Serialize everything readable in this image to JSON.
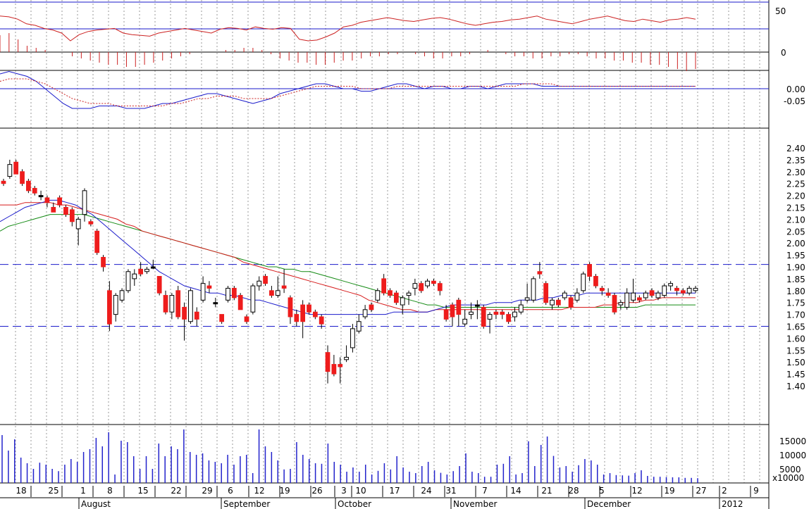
{
  "chart_data": {
    "type": "candlestick",
    "grid": "vertical dotted at day ticks",
    "x_day_labels": [
      "18",
      "25",
      "1",
      "8",
      "15",
      "22",
      "29",
      "6",
      "12",
      "19",
      "26",
      "3",
      "10",
      "17",
      "24",
      "31",
      "7",
      "14",
      "21",
      "28",
      "5",
      "12",
      "19",
      "27",
      "2",
      "9"
    ],
    "x_month_labels": [
      "August",
      "September",
      "October",
      "November",
      "December",
      "2012"
    ],
    "panels": {
      "rsi": {
        "yticks": [
          "50",
          "0"
        ],
        "reference_lines": [
          70,
          30
        ],
        "ylim": [
          0,
          100
        ],
        "values": [
          62,
          61,
          58,
          52,
          50,
          46,
          44,
          40,
          30,
          38,
          42,
          44,
          45,
          46,
          40,
          38,
          37,
          36,
          40,
          42,
          44,
          46,
          44,
          42,
          40,
          45,
          47,
          46,
          44,
          48,
          46,
          45,
          47,
          46,
          32,
          30,
          31,
          35,
          40,
          48,
          50,
          54,
          56,
          58,
          60,
          58,
          56,
          55,
          57,
          59,
          60,
          58,
          55,
          52,
          50,
          52,
          54,
          55,
          57,
          58,
          60,
          62,
          58,
          56,
          54,
          52,
          55,
          58,
          60,
          62,
          59,
          56,
          55,
          58,
          56,
          54,
          57,
          58,
          60,
          58
        ]
      },
      "hist": {
        "yticks": [
          "0"
        ],
        "values": [
          8,
          9,
          6,
          3,
          2,
          1,
          0,
          0,
          -2,
          -3,
          -4,
          -5,
          -6,
          -6,
          -7,
          -7,
          -6,
          -5,
          -4,
          -3,
          -2,
          -1,
          0,
          0,
          0,
          1,
          1,
          2,
          2,
          1,
          -1,
          -3,
          -4,
          -5,
          -5,
          -6,
          -6,
          -5,
          -4,
          -4,
          -3,
          -2,
          -2,
          -1,
          -1,
          0,
          -1,
          -2,
          -3,
          -3,
          -2,
          -2,
          -1,
          0,
          1,
          0,
          -1,
          -2,
          -2,
          -3,
          -3,
          -2,
          -2,
          -1,
          -1,
          -2,
          -3,
          -3,
          -4,
          -4,
          -5,
          -5,
          -6,
          -6,
          -7,
          -8,
          -9,
          -8
        ]
      },
      "macd": {
        "yticks": [
          "0.00",
          "-0.05"
        ],
        "macd": [
          0.06,
          0.07,
          0.06,
          0.05,
          0.03,
          0.0,
          -0.03,
          -0.06,
          -0.08,
          -0.08,
          -0.08,
          -0.07,
          -0.07,
          -0.07,
          -0.08,
          -0.08,
          -0.08,
          -0.07,
          -0.06,
          -0.06,
          -0.05,
          -0.04,
          -0.03,
          -0.02,
          -0.02,
          -0.03,
          -0.04,
          -0.05,
          -0.06,
          -0.05,
          -0.04,
          -0.02,
          -0.01,
          0.0,
          0.01,
          0.02,
          0.02,
          0.01,
          0.0,
          0.0,
          -0.01,
          -0.01,
          0.0,
          0.01,
          0.02,
          0.02,
          0.01,
          0.0,
          0.01,
          0.01,
          0.0,
          0.0,
          0.01,
          0.01,
          0.0,
          0.01,
          0.02,
          0.02,
          0.02,
          0.02,
          0.01,
          0.01,
          0.01,
          0.01,
          0.01,
          0.01,
          0.01,
          0.01,
          0.01,
          0.01,
          0.01,
          0.01,
          0.01,
          0.01,
          0.01,
          0.01,
          0.01,
          0.01
        ],
        "signal": [
          0.03,
          0.04,
          0.04,
          0.04,
          0.03,
          0.02,
          0.0,
          -0.02,
          -0.04,
          -0.05,
          -0.06,
          -0.06,
          -0.06,
          -0.07,
          -0.07,
          -0.07,
          -0.07,
          -0.07,
          -0.07,
          -0.06,
          -0.06,
          -0.05,
          -0.04,
          -0.04,
          -0.03,
          -0.03,
          -0.03,
          -0.04,
          -0.04,
          -0.04,
          -0.04,
          -0.03,
          -0.02,
          -0.01,
          0.0,
          0.01,
          0.01,
          0.01,
          0.01,
          0.01,
          0.0,
          0.0,
          0.0,
          0.0,
          0.01,
          0.01,
          0.01,
          0.01,
          0.01,
          0.01,
          0.01,
          0.01,
          0.01,
          0.01,
          0.01,
          0.01,
          0.01,
          0.01,
          0.02,
          0.02,
          0.02,
          0.02,
          0.01,
          0.01,
          0.01,
          0.01,
          0.01,
          0.01,
          0.01,
          0.01,
          0.01,
          0.01,
          0.01,
          0.01,
          0.01,
          0.01,
          0.01,
          0.01
        ]
      },
      "price": {
        "yticks": [
          "2.40",
          "2.35",
          "2.30",
          "2.25",
          "2.20",
          "2.15",
          "2.10",
          "2.05",
          "2.00",
          "1.95",
          "1.90",
          "1.85",
          "1.80",
          "1.75",
          "1.70",
          "1.65",
          "1.60",
          "1.55",
          "1.50",
          "1.45",
          "1.40"
        ],
        "ylim": [
          1.35,
          2.42
        ],
        "reference_levels": [
          1.91,
          1.65
        ]
      },
      "volume": {
        "yticks": [
          "15000",
          "10000",
          "5000"
        ],
        "unit_label": "x10000",
        "ylim": [
          0,
          20000
        ]
      }
    },
    "candles": [
      [
        2.26,
        2.27,
        2.24,
        2.25
      ],
      [
        2.28,
        2.35,
        2.27,
        2.33
      ],
      [
        2.34,
        2.35,
        2.29,
        2.29
      ],
      [
        2.3,
        2.31,
        2.24,
        2.25
      ],
      [
        2.26,
        2.27,
        2.21,
        2.22
      ],
      [
        2.23,
        2.24,
        2.2,
        2.21
      ],
      [
        2.2,
        2.22,
        2.18,
        2.2
      ],
      [
        2.19,
        2.2,
        2.15,
        2.17
      ],
      [
        2.15,
        2.17,
        2.13,
        2.13
      ],
      [
        2.19,
        2.2,
        2.15,
        2.16
      ],
      [
        2.15,
        2.16,
        2.11,
        2.12
      ],
      [
        2.14,
        2.15,
        2.07,
        2.09
      ],
      [
        2.06,
        2.11,
        1.99,
        2.1
      ],
      [
        2.12,
        2.23,
        2.09,
        2.22
      ],
      [
        2.09,
        2.1,
        2.07,
        2.08
      ],
      [
        2.05,
        2.06,
        1.95,
        1.96
      ],
      [
        1.94,
        1.95,
        1.88,
        1.9
      ],
      [
        1.8,
        1.84,
        1.63,
        1.66
      ],
      [
        1.7,
        1.79,
        1.67,
        1.78
      ],
      [
        1.76,
        1.81,
        1.75,
        1.8
      ],
      [
        1.8,
        1.89,
        1.79,
        1.88
      ],
      [
        1.85,
        1.89,
        1.82,
        1.87
      ],
      [
        1.89,
        1.92,
        1.86,
        1.87
      ],
      [
        1.88,
        1.9,
        1.87,
        1.89
      ],
      [
        1.9,
        1.93,
        1.89,
        1.9
      ],
      [
        1.86,
        1.86,
        1.78,
        1.79
      ],
      [
        1.78,
        1.8,
        1.7,
        1.71
      ],
      [
        1.71,
        1.79,
        1.68,
        1.78
      ],
      [
        1.8,
        1.82,
        1.68,
        1.69
      ],
      [
        1.73,
        1.75,
        1.59,
        1.68
      ],
      [
        1.67,
        1.81,
        1.66,
        1.8
      ],
      [
        1.71,
        1.73,
        1.65,
        1.68
      ],
      [
        1.76,
        1.86,
        1.75,
        1.83
      ],
      [
        1.82,
        1.84,
        1.79,
        1.81
      ],
      [
        1.75,
        1.77,
        1.73,
        1.75
      ],
      [
        1.7,
        1.69,
        1.66,
        1.67
      ],
      [
        1.76,
        1.82,
        1.75,
        1.81
      ],
      [
        1.81,
        1.82,
        1.76,
        1.77
      ],
      [
        1.78,
        1.79,
        1.72,
        1.72
      ],
      [
        1.69,
        1.7,
        1.66,
        1.67
      ],
      [
        1.71,
        1.83,
        1.7,
        1.82
      ],
      [
        1.82,
        1.86,
        1.8,
        1.84
      ],
      [
        1.86,
        1.87,
        1.82,
        1.83
      ],
      [
        1.8,
        1.82,
        1.77,
        1.78
      ],
      [
        1.78,
        1.86,
        1.77,
        1.8
      ],
      [
        1.82,
        1.89,
        1.79,
        1.81
      ],
      [
        1.77,
        1.78,
        1.66,
        1.69
      ],
      [
        1.7,
        1.72,
        1.65,
        1.67
      ],
      [
        1.74,
        1.76,
        1.6,
        1.67
      ],
      [
        1.74,
        1.75,
        1.7,
        1.71
      ],
      [
        1.71,
        1.72,
        1.68,
        1.69
      ],
      [
        1.69,
        1.7,
        1.64,
        1.66
      ],
      [
        1.54,
        1.57,
        1.41,
        1.46
      ],
      [
        1.49,
        1.53,
        1.44,
        1.45
      ],
      [
        1.49,
        1.52,
        1.41,
        1.48
      ],
      [
        1.51,
        1.57,
        1.5,
        1.52
      ],
      [
        1.56,
        1.66,
        1.54,
        1.64
      ],
      [
        1.63,
        1.7,
        1.62,
        1.67
      ],
      [
        1.69,
        1.74,
        1.68,
        1.72
      ],
      [
        1.74,
        1.75,
        1.71,
        1.72
      ],
      [
        1.76,
        1.81,
        1.75,
        1.8
      ],
      [
        1.85,
        1.87,
        1.78,
        1.79
      ],
      [
        1.8,
        1.81,
        1.77,
        1.78
      ],
      [
        1.79,
        1.8,
        1.74,
        1.75
      ],
      [
        1.74,
        1.78,
        1.7,
        1.77
      ],
      [
        1.78,
        1.8,
        1.74,
        1.79
      ],
      [
        1.81,
        1.85,
        1.78,
        1.83
      ],
      [
        1.83,
        1.84,
        1.79,
        1.8
      ],
      [
        1.82,
        1.85,
        1.81,
        1.84
      ],
      [
        1.84,
        1.85,
        1.82,
        1.83
      ],
      [
        1.83,
        1.84,
        1.78,
        1.8
      ],
      [
        1.72,
        1.74,
        1.67,
        1.68
      ],
      [
        1.74,
        1.75,
        1.65,
        1.69
      ],
      [
        1.76,
        1.77,
        1.65,
        1.7
      ],
      [
        1.66,
        1.72,
        1.65,
        1.68
      ],
      [
        1.7,
        1.75,
        1.68,
        1.71
      ],
      [
        1.74,
        1.76,
        1.68,
        1.74
      ],
      [
        1.73,
        1.74,
        1.64,
        1.65
      ],
      [
        1.68,
        1.71,
        1.62,
        1.7
      ],
      [
        1.71,
        1.72,
        1.68,
        1.7
      ],
      [
        1.71,
        1.72,
        1.68,
        1.7
      ],
      [
        1.7,
        1.71,
        1.66,
        1.67
      ],
      [
        1.69,
        1.73,
        1.67,
        1.71
      ],
      [
        1.71,
        1.76,
        1.7,
        1.74
      ],
      [
        1.76,
        1.83,
        1.75,
        1.77
      ],
      [
        1.76,
        1.86,
        1.75,
        1.85
      ],
      [
        1.88,
        1.92,
        1.85,
        1.87
      ],
      [
        1.83,
        1.84,
        1.74,
        1.75
      ],
      [
        1.74,
        1.77,
        1.72,
        1.76
      ],
      [
        1.76,
        1.77,
        1.73,
        1.74
      ],
      [
        1.77,
        1.8,
        1.76,
        1.79
      ],
      [
        1.77,
        1.78,
        1.72,
        1.73
      ],
      [
        1.76,
        1.81,
        1.75,
        1.79
      ],
      [
        1.8,
        1.88,
        1.79,
        1.87
      ],
      [
        1.91,
        1.92,
        1.84,
        1.86
      ],
      [
        1.86,
        1.87,
        1.81,
        1.82
      ],
      [
        1.81,
        1.82,
        1.78,
        1.8
      ],
      [
        1.79,
        1.81,
        1.77,
        1.78
      ],
      [
        1.78,
        1.79,
        1.7,
        1.71
      ],
      [
        1.74,
        1.76,
        1.72,
        1.75
      ],
      [
        1.73,
        1.81,
        1.72,
        1.79
      ],
      [
        1.76,
        1.85,
        1.75,
        1.79
      ],
      [
        1.77,
        1.78,
        1.75,
        1.76
      ],
      [
        1.77,
        1.8,
        1.76,
        1.79
      ],
      [
        1.8,
        1.81,
        1.77,
        1.78
      ],
      [
        1.77,
        1.8,
        1.76,
        1.79
      ],
      [
        1.78,
        1.83,
        1.77,
        1.82
      ],
      [
        1.82,
        1.84,
        1.8,
        1.83
      ],
      [
        1.81,
        1.82,
        1.78,
        1.8
      ],
      [
        1.8,
        1.81,
        1.78,
        1.79
      ],
      [
        1.79,
        1.82,
        1.78,
        1.81
      ],
      [
        1.8,
        1.82,
        1.79,
        1.81
      ]
    ],
    "ma_red": [
      2.16,
      2.16,
      2.16,
      2.17,
      2.17,
      2.17,
      2.17,
      2.16,
      2.16,
      2.15,
      2.14,
      2.13,
      2.12,
      2.11,
      2.1,
      2.08,
      2.07,
      2.05,
      2.04,
      2.03,
      2.02,
      2.01,
      2.0,
      1.99,
      1.98,
      1.97,
      1.96,
      1.95,
      1.94,
      1.92,
      1.91,
      1.9,
      1.89,
      1.88,
      1.87,
      1.86,
      1.85,
      1.84,
      1.83,
      1.82,
      1.81,
      1.8,
      1.79,
      1.78,
      1.76,
      1.75,
      1.74,
      1.73,
      1.72,
      1.72,
      1.71,
      1.71,
      1.72,
      1.72,
      1.72,
      1.72,
      1.72,
      1.72,
      1.72,
      1.72,
      1.72,
      1.72,
      1.72,
      1.72,
      1.72,
      1.72,
      1.72,
      1.72,
      1.73,
      1.73,
      1.73,
      1.73,
      1.74,
      1.74,
      1.75,
      1.75,
      1.75,
      1.76,
      1.76,
      1.77,
      1.77,
      1.77,
      1.77,
      1.77
    ],
    "ma_blue": [
      2.09,
      2.11,
      2.13,
      2.15,
      2.16,
      2.17,
      2.18,
      2.18,
      2.17,
      2.16,
      2.14,
      2.12,
      2.09,
      2.06,
      2.03,
      2.0,
      1.97,
      1.94,
      1.91,
      1.88,
      1.86,
      1.84,
      1.82,
      1.81,
      1.8,
      1.79,
      1.79,
      1.78,
      1.78,
      1.77,
      1.76,
      1.76,
      1.75,
      1.74,
      1.73,
      1.72,
      1.71,
      1.7,
      1.7,
      1.7,
      1.7,
      1.7,
      1.7,
      1.7,
      1.7,
      1.7,
      1.7,
      1.71,
      1.71,
      1.71,
      1.71,
      1.71,
      1.72,
      1.73,
      1.74,
      1.74,
      1.74,
      1.74,
      1.74,
      1.75,
      1.75,
      1.75,
      1.76,
      1.76,
      1.76,
      1.77,
      1.77,
      1.78,
      1.78,
      1.78,
      1.79,
      1.79,
      1.79,
      1.79,
      1.79,
      1.79,
      1.79,
      1.79,
      1.79,
      1.79,
      1.79,
      1.79,
      1.79,
      1.79
    ],
    "ma_green": [
      2.05,
      2.07,
      2.08,
      2.09,
      2.1,
      2.11,
      2.12,
      2.12,
      2.12,
      2.12,
      2.12,
      2.11,
      2.1,
      2.09,
      2.08,
      2.07,
      2.06,
      2.05,
      2.04,
      2.03,
      2.02,
      2.01,
      2.0,
      1.99,
      1.98,
      1.97,
      1.96,
      1.95,
      1.94,
      1.93,
      1.92,
      1.91,
      1.9,
      1.9,
      1.89,
      1.89,
      1.88,
      1.88,
      1.87,
      1.86,
      1.85,
      1.84,
      1.83,
      1.82,
      1.81,
      1.8,
      1.79,
      1.78,
      1.77,
      1.76,
      1.75,
      1.74,
      1.74,
      1.73,
      1.73,
      1.73,
      1.73,
      1.73,
      1.73,
      1.73,
      1.73,
      1.73,
      1.73,
      1.73,
      1.73,
      1.73,
      1.73,
      1.73,
      1.73,
      1.73,
      1.73,
      1.73,
      1.73,
      1.73,
      1.73,
      1.73,
      1.73,
      1.74,
      1.74,
      1.74,
      1.74,
      1.74,
      1.74,
      1.74
    ],
    "volume": [
      17000,
      11500,
      15500,
      9000,
      7000,
      5000,
      7200,
      6500,
      5000,
      4200,
      6500,
      8500,
      7500,
      11000,
      12000,
      16000,
      13000,
      18000,
      3000,
      15000,
      14500,
      9500,
      5000,
      9500,
      5000,
      14000,
      9500,
      13000,
      12000,
      19000,
      11000,
      10000,
      10500,
      8000,
      7500,
      7000,
      10000,
      6500,
      9500,
      10000,
      3500,
      19000,
      13000,
      11000,
      8000,
      4800,
      5000,
      14500,
      10000,
      8500,
      7000,
      6800,
      14000,
      7500,
      6500,
      4000,
      5500,
      4000,
      6500,
      3000,
      4300,
      7000,
      4800,
      9500,
      5500,
      4000,
      3500,
      6000,
      7500,
      4500,
      3600,
      3000,
      4200,
      6000,
      10500,
      4000,
      3500,
      2200,
      2200,
      6500,
      6800,
      9500,
      3000,
      3500,
      14800,
      6000,
      13500,
      16500,
      9600,
      5500,
      6000,
      4000,
      6300,
      8500,
      8000,
      6500,
      3000,
      3500,
      2800,
      2700,
      2600,
      3500,
      4500,
      2500,
      2200,
      2200,
      2100,
      2000,
      2000,
      1800,
      1800,
      1700
    ]
  },
  "colors": {
    "up_fill": "#ffffff",
    "down_fill": "#ee1c1c",
    "doji_fill": "#000000",
    "ma_red": "#d61b1b",
    "ma_blue": "#1a1acb",
    "ma_green": "#138a13",
    "volume": "#2222cc",
    "ref_line": "#1a1acb",
    "rsi_line": "#cc2222",
    "hist_bar": "#cc2222",
    "macd_line": "#1a1acb",
    "signal_line": "#cc2222",
    "grid": "#9a9a9a"
  }
}
